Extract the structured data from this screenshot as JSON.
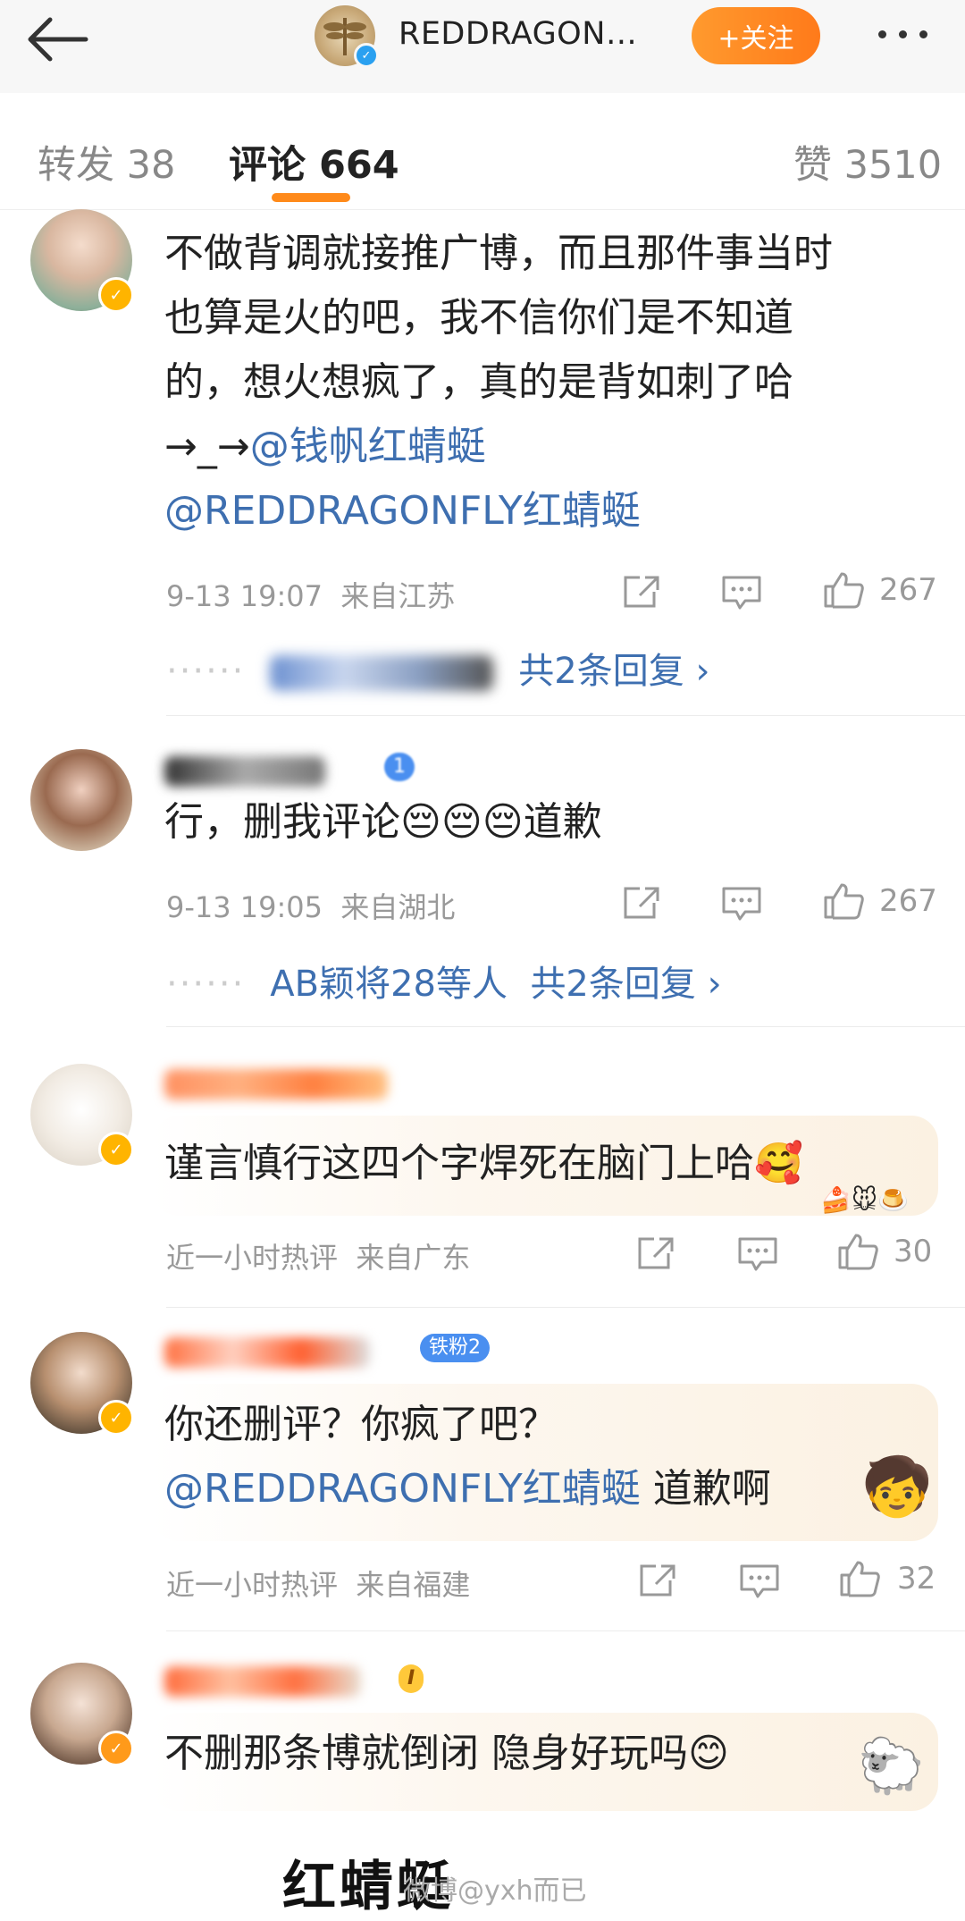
{
  "header": {
    "title": "REDDRAGON…",
    "follow_label": "+关注"
  },
  "tabs": [
    {
      "label": "转发 38"
    },
    {
      "label": "评论 664"
    },
    {
      "label": "赞 3510"
    }
  ],
  "comments": [
    {
      "text": "不做背调就接推广博，而且那件事当时也算是火的吧，我不信你们是不知道的，想火想疯了，真的是背如刺了哈→_→",
      "mentions": [
        "@钱帆红蜻蜓",
        "@REDDRAGONFLY红蜻蜓"
      ],
      "time": "9-13 19:07",
      "location": "来自江苏",
      "likes": "267",
      "reply_summary": "共2条回复 ›"
    },
    {
      "text": "行，删我评论😔😔😔道歉",
      "fan_level": "1",
      "time": "9-13 19:05",
      "location": "来自湖北",
      "likes": "267",
      "reply_names": "AB颖将28等人",
      "reply_summary": "共2条回复 ›"
    },
    {
      "text": "谨言慎行这四个字焊死在脑门上哈🥰",
      "time": "近一小时热评",
      "location": "来自广东",
      "likes": "30"
    },
    {
      "text": "你还删评？你疯了吧？",
      "mention": "@REDDRAGONFLY红蜻蜓",
      "text_after": " 道歉啊",
      "fan_badge": "铁粉2",
      "time": "近一小时热评",
      "location": "来自福建",
      "likes": "32"
    },
    {
      "text": "不删那条博就倒闭 隐身好玩吗😊",
      "level_badge": "I"
    }
  ],
  "footer": {
    "partial_heading": "红蜻蜓",
    "watermark": "微博@yxh而已"
  },
  "colors": {
    "accent": "#ff8a1a",
    "link": "#3e6fb0",
    "meta": "#999999"
  }
}
